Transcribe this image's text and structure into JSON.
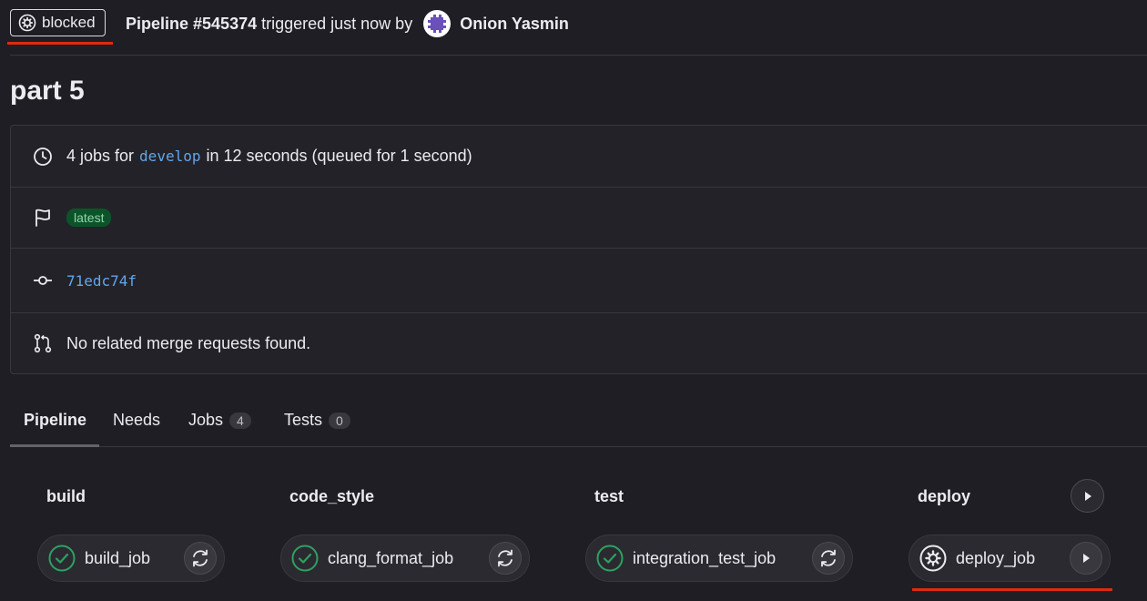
{
  "header": {
    "status_label": "blocked",
    "pipeline_ref": "Pipeline #545374",
    "triggered_text": "triggered just now by",
    "user_name": "Onion Yasmin"
  },
  "page": {
    "title": "part 5"
  },
  "info": {
    "jobs_prefix": "4 jobs for",
    "branch": "develop",
    "jobs_suffix": "in 12 seconds (queued for 1 second)",
    "tag": "latest",
    "commit_sha": "71edc74f",
    "merge_requests": "No related merge requests found."
  },
  "tabs": [
    {
      "label": "Pipeline",
      "count": null,
      "active": true
    },
    {
      "label": "Needs",
      "count": null,
      "active": false
    },
    {
      "label": "Jobs",
      "count": "4",
      "active": false
    },
    {
      "label": "Tests",
      "count": "0",
      "active": false
    }
  ],
  "stages": [
    {
      "name": "build",
      "job": "build_job",
      "job_status": "success",
      "action": "retry"
    },
    {
      "name": "code_style",
      "job": "clang_format_job",
      "job_status": "success",
      "action": "retry"
    },
    {
      "name": "test",
      "job": "integration_test_job",
      "job_status": "success",
      "action": "retry"
    },
    {
      "name": "deploy",
      "job": "deploy_job",
      "job_status": "manual",
      "action": "play"
    }
  ],
  "colors": {
    "success": "#2da160",
    "danger_underline": "#dd2b0e",
    "link": "#63a6e9",
    "tag_bg": "#0d532a"
  },
  "icons": {
    "status": "gear-icon",
    "clock": "clock-icon",
    "flag": "flag-icon",
    "commit": "commit-icon",
    "merge_request": "merge-request-icon",
    "success": "check-circle-icon",
    "retry": "retry-icon",
    "play": "play-icon"
  }
}
